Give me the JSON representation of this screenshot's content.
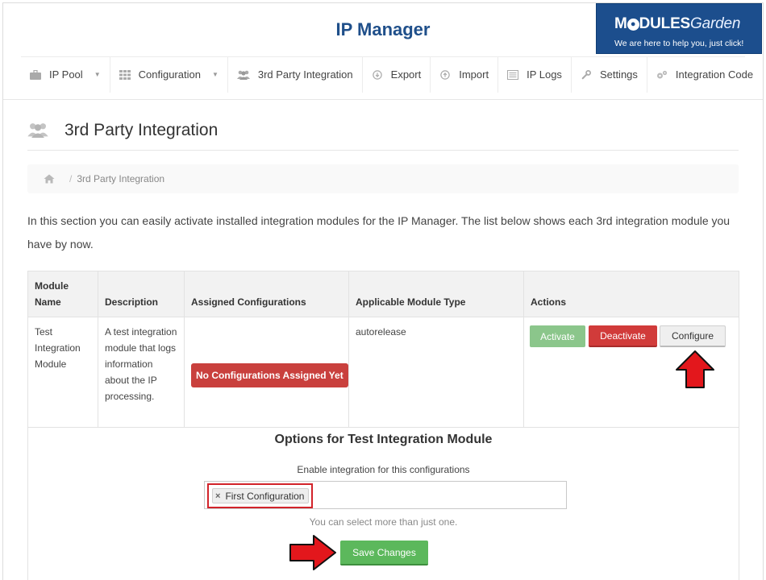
{
  "app": {
    "title": "IP Manager"
  },
  "logo": {
    "brand_a": "M",
    "brand_b": "DULES",
    "brand_c": "Garden",
    "tagline": "We are here to help you, just click!"
  },
  "nav": {
    "items": [
      {
        "label": "IP Pool",
        "icon": "briefcase-icon",
        "dropdown": true
      },
      {
        "label": "Configuration",
        "icon": "grid-icon",
        "dropdown": true
      },
      {
        "label": "3rd Party Integration",
        "icon": "users-icon",
        "dropdown": false
      },
      {
        "label": "Export",
        "icon": "export-icon",
        "dropdown": false
      },
      {
        "label": "Import",
        "icon": "import-icon",
        "dropdown": false
      },
      {
        "label": "IP Logs",
        "icon": "list-icon",
        "dropdown": false
      },
      {
        "label": "Settings",
        "icon": "wrench-icon",
        "dropdown": false
      },
      {
        "label": "Integration Code",
        "icon": "gears-icon",
        "dropdown": false
      }
    ]
  },
  "page": {
    "title": "3rd Party Integration",
    "breadcrumb_current": "3rd Party Integration",
    "intro": "In this section you can easily activate installed integration modules for the IP Manager. The list below shows each 3rd integration module you have by now."
  },
  "table": {
    "headers": {
      "module_name_line1": "Module",
      "module_name_line2": "Name",
      "description": "Description",
      "assigned": "Assigned Configurations",
      "applicable": "Applicable Module Type",
      "actions": "Actions"
    },
    "row": {
      "name": "Test Integration Module",
      "description": "A test integration module that logs information about the IP processing.",
      "assigned_badge": "No Configurations Assigned Yet",
      "module_type": "autorelease",
      "btn_activate": "Activate",
      "btn_deactivate": "Deactivate",
      "btn_configure": "Configure"
    }
  },
  "options": {
    "title": "Options for Test Integration Module",
    "label": "Enable integration for this configurations",
    "selected": "First Configuration",
    "remove_glyph": "×",
    "help": "You can select more than just one.",
    "save_label": "Save Changes"
  },
  "colors": {
    "title_blue": "#1f4f8a",
    "logo_bg": "#1c4e8d",
    "activate": "#8bc68b",
    "deactivate": "#d13b3a",
    "save": "#5cb85c",
    "badge": "#c9403d",
    "highlight_red": "#d2232a"
  }
}
